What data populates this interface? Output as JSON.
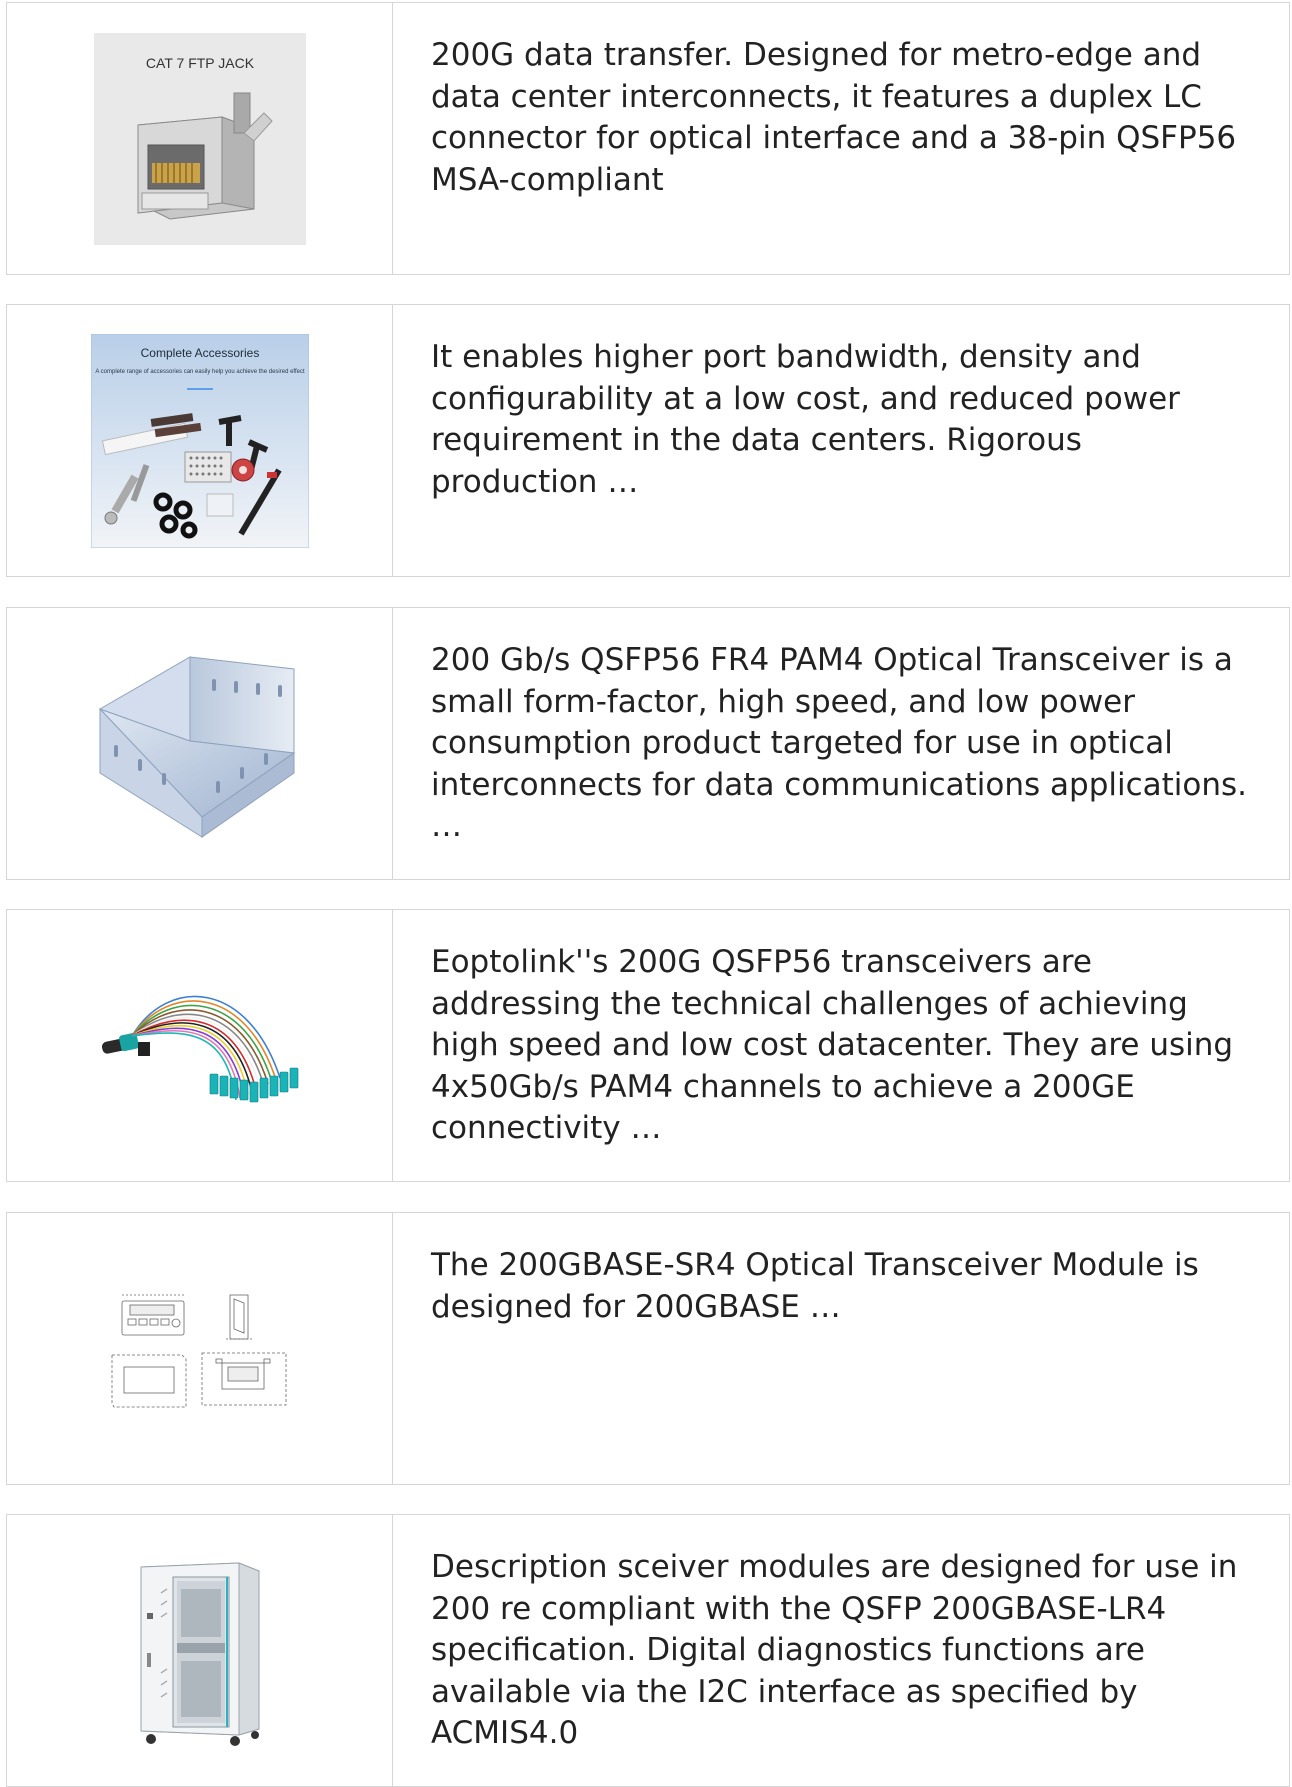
{
  "products": [
    {
      "image_name": "cat7-ftp-jack-image",
      "image_caption": "CAT 7 FTP JACK",
      "description": "200G data transfer. Designed for metro-edge and data center interconnects, it features a duplex LC connector for optical interface and a 38-pin QSFP56 MSA-compliant"
    },
    {
      "image_name": "accessories-kit-image",
      "image_caption": "Complete Accessories",
      "image_subcaption": "A complete range of accessories can easily help you achieve the desired effect",
      "description": "It enables higher port bandwidth, density and configurability at a low cost, and reduced power requirement in the data centers. Rigorous production …"
    },
    {
      "image_name": "cable-tray-image",
      "description": "200 Gb/s QSFP56 FR4 PAM4 Optical Transceiver is a small form-factor, high speed, and low power consumption product targeted for use in optical interconnects for data communications applications. …"
    },
    {
      "image_name": "fiber-fanout-cable-image",
      "description": "Eoptolink''s 200G QSFP56 transceivers are addressing the technical challenges of achieving high speed and low cost datacenter. They are using 4x50Gb/s PAM4 channels to achieve a 200GE connectivity …"
    },
    {
      "image_name": "technical-drawing-image",
      "description": "The 200GBASE-SR4 Optical Transceiver Module is designed for 200GBASE …"
    },
    {
      "image_name": "server-cabinet-image",
      "description": "Description sceiver modules are designed for use in 200 re compliant with the QSFP 200GBASE-LR4 specification. Digital diagnostics functions are available via the I2C interface as specified by ACMIS4.0"
    }
  ]
}
